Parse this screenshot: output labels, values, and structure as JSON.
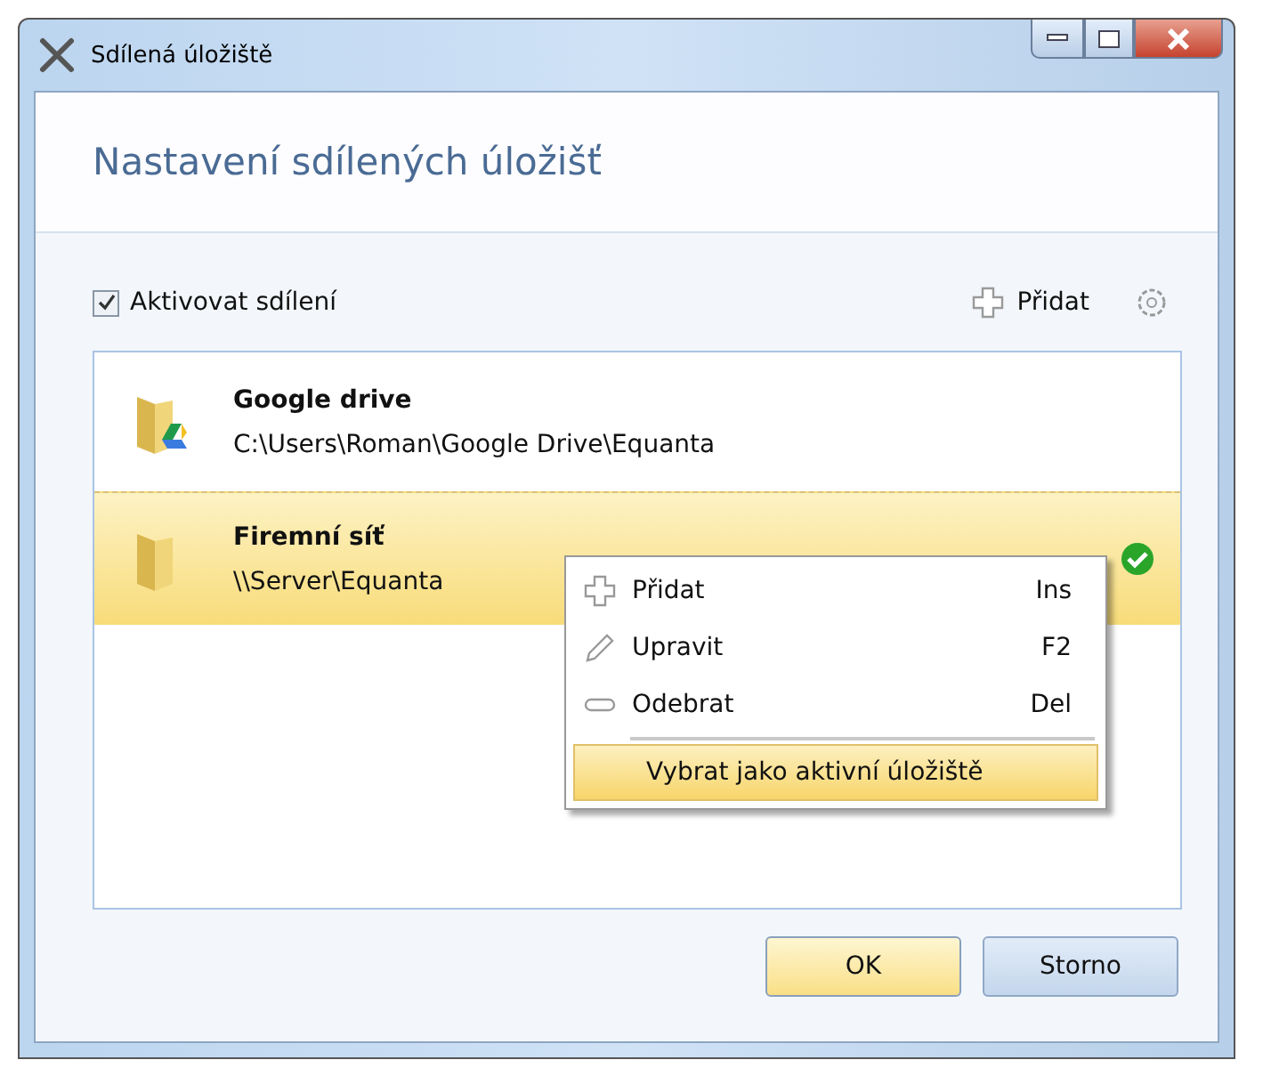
{
  "window": {
    "title": "Sdílená úložiště"
  },
  "header": {
    "title": "Nastavení sdílených úložišť"
  },
  "toolbar": {
    "enable_sharing": {
      "label": "Aktivovat sdílení",
      "checked": true
    },
    "add_label": "Přidat"
  },
  "storages": [
    {
      "name": "Google drive",
      "path": "C:\\Users\\Roman\\Google Drive\\Equanta",
      "kind": "gdrive",
      "selected": false,
      "active": false
    },
    {
      "name": "Firemní síť",
      "path": "\\\\Server\\Equanta",
      "kind": "folder",
      "selected": true,
      "active": true
    }
  ],
  "context_menu": [
    {
      "kind": "add",
      "label": "Přidat",
      "shortcut": "Ins",
      "selected": false
    },
    {
      "kind": "edit",
      "label": "Upravit",
      "shortcut": "F2",
      "selected": false
    },
    {
      "kind": "remove",
      "label": "Odebrat",
      "shortcut": "Del",
      "selected": false
    },
    {
      "kind": "separator"
    },
    {
      "kind": "plain",
      "label": "Vybrat jako aktivní úložiště",
      "selected": true
    }
  ],
  "buttons": [
    {
      "label": "OK",
      "default": true
    },
    {
      "label": "Storno",
      "default": false
    }
  ]
}
